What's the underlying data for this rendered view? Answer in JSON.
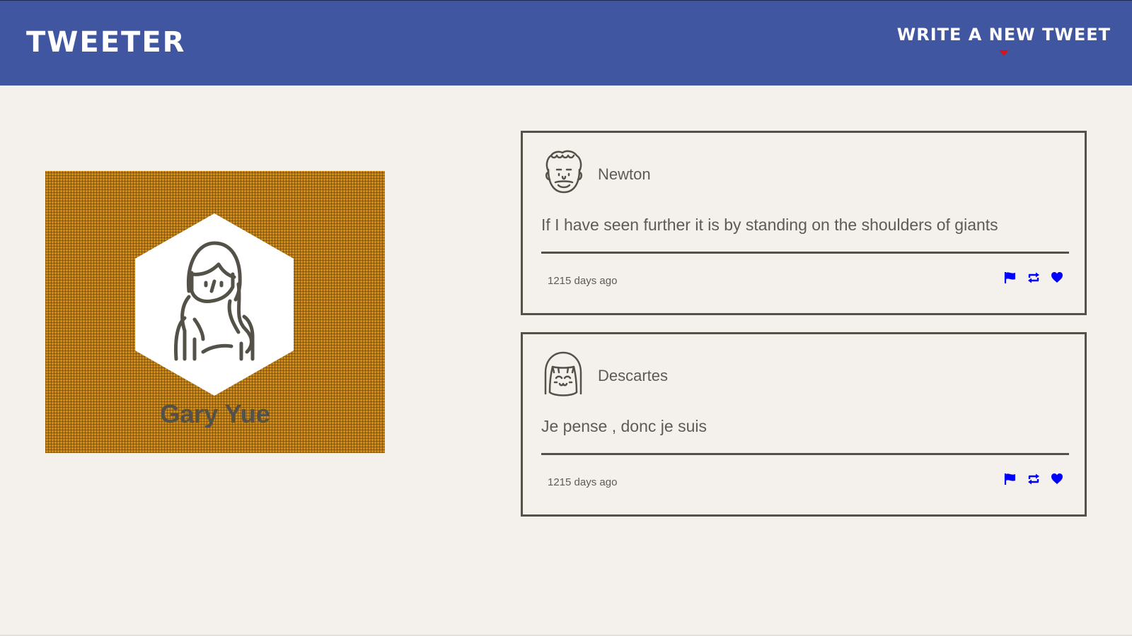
{
  "header": {
    "brand": "TWEETER",
    "compose_label": "WRITE A NEW TWEET"
  },
  "profile": {
    "name": "Gary Yue"
  },
  "tweets": [
    {
      "author": "Newton",
      "text": "If I have seen further it is by standing on the shoulders of giants",
      "time": "1215 days ago"
    },
    {
      "author": "Descartes",
      "text": "Je pense , donc je suis",
      "time": "1215 days ago"
    }
  ],
  "icons": {
    "flag": "flag-icon",
    "retweet": "retweet-icon",
    "like": "heart-icon"
  },
  "colors": {
    "header_bg": "#4056a1",
    "page_bg": "#f4f1ec",
    "profile_bg": "#d48b08",
    "caret": "#d8141a",
    "action_icons": "#0000ff",
    "text": "#545149"
  }
}
